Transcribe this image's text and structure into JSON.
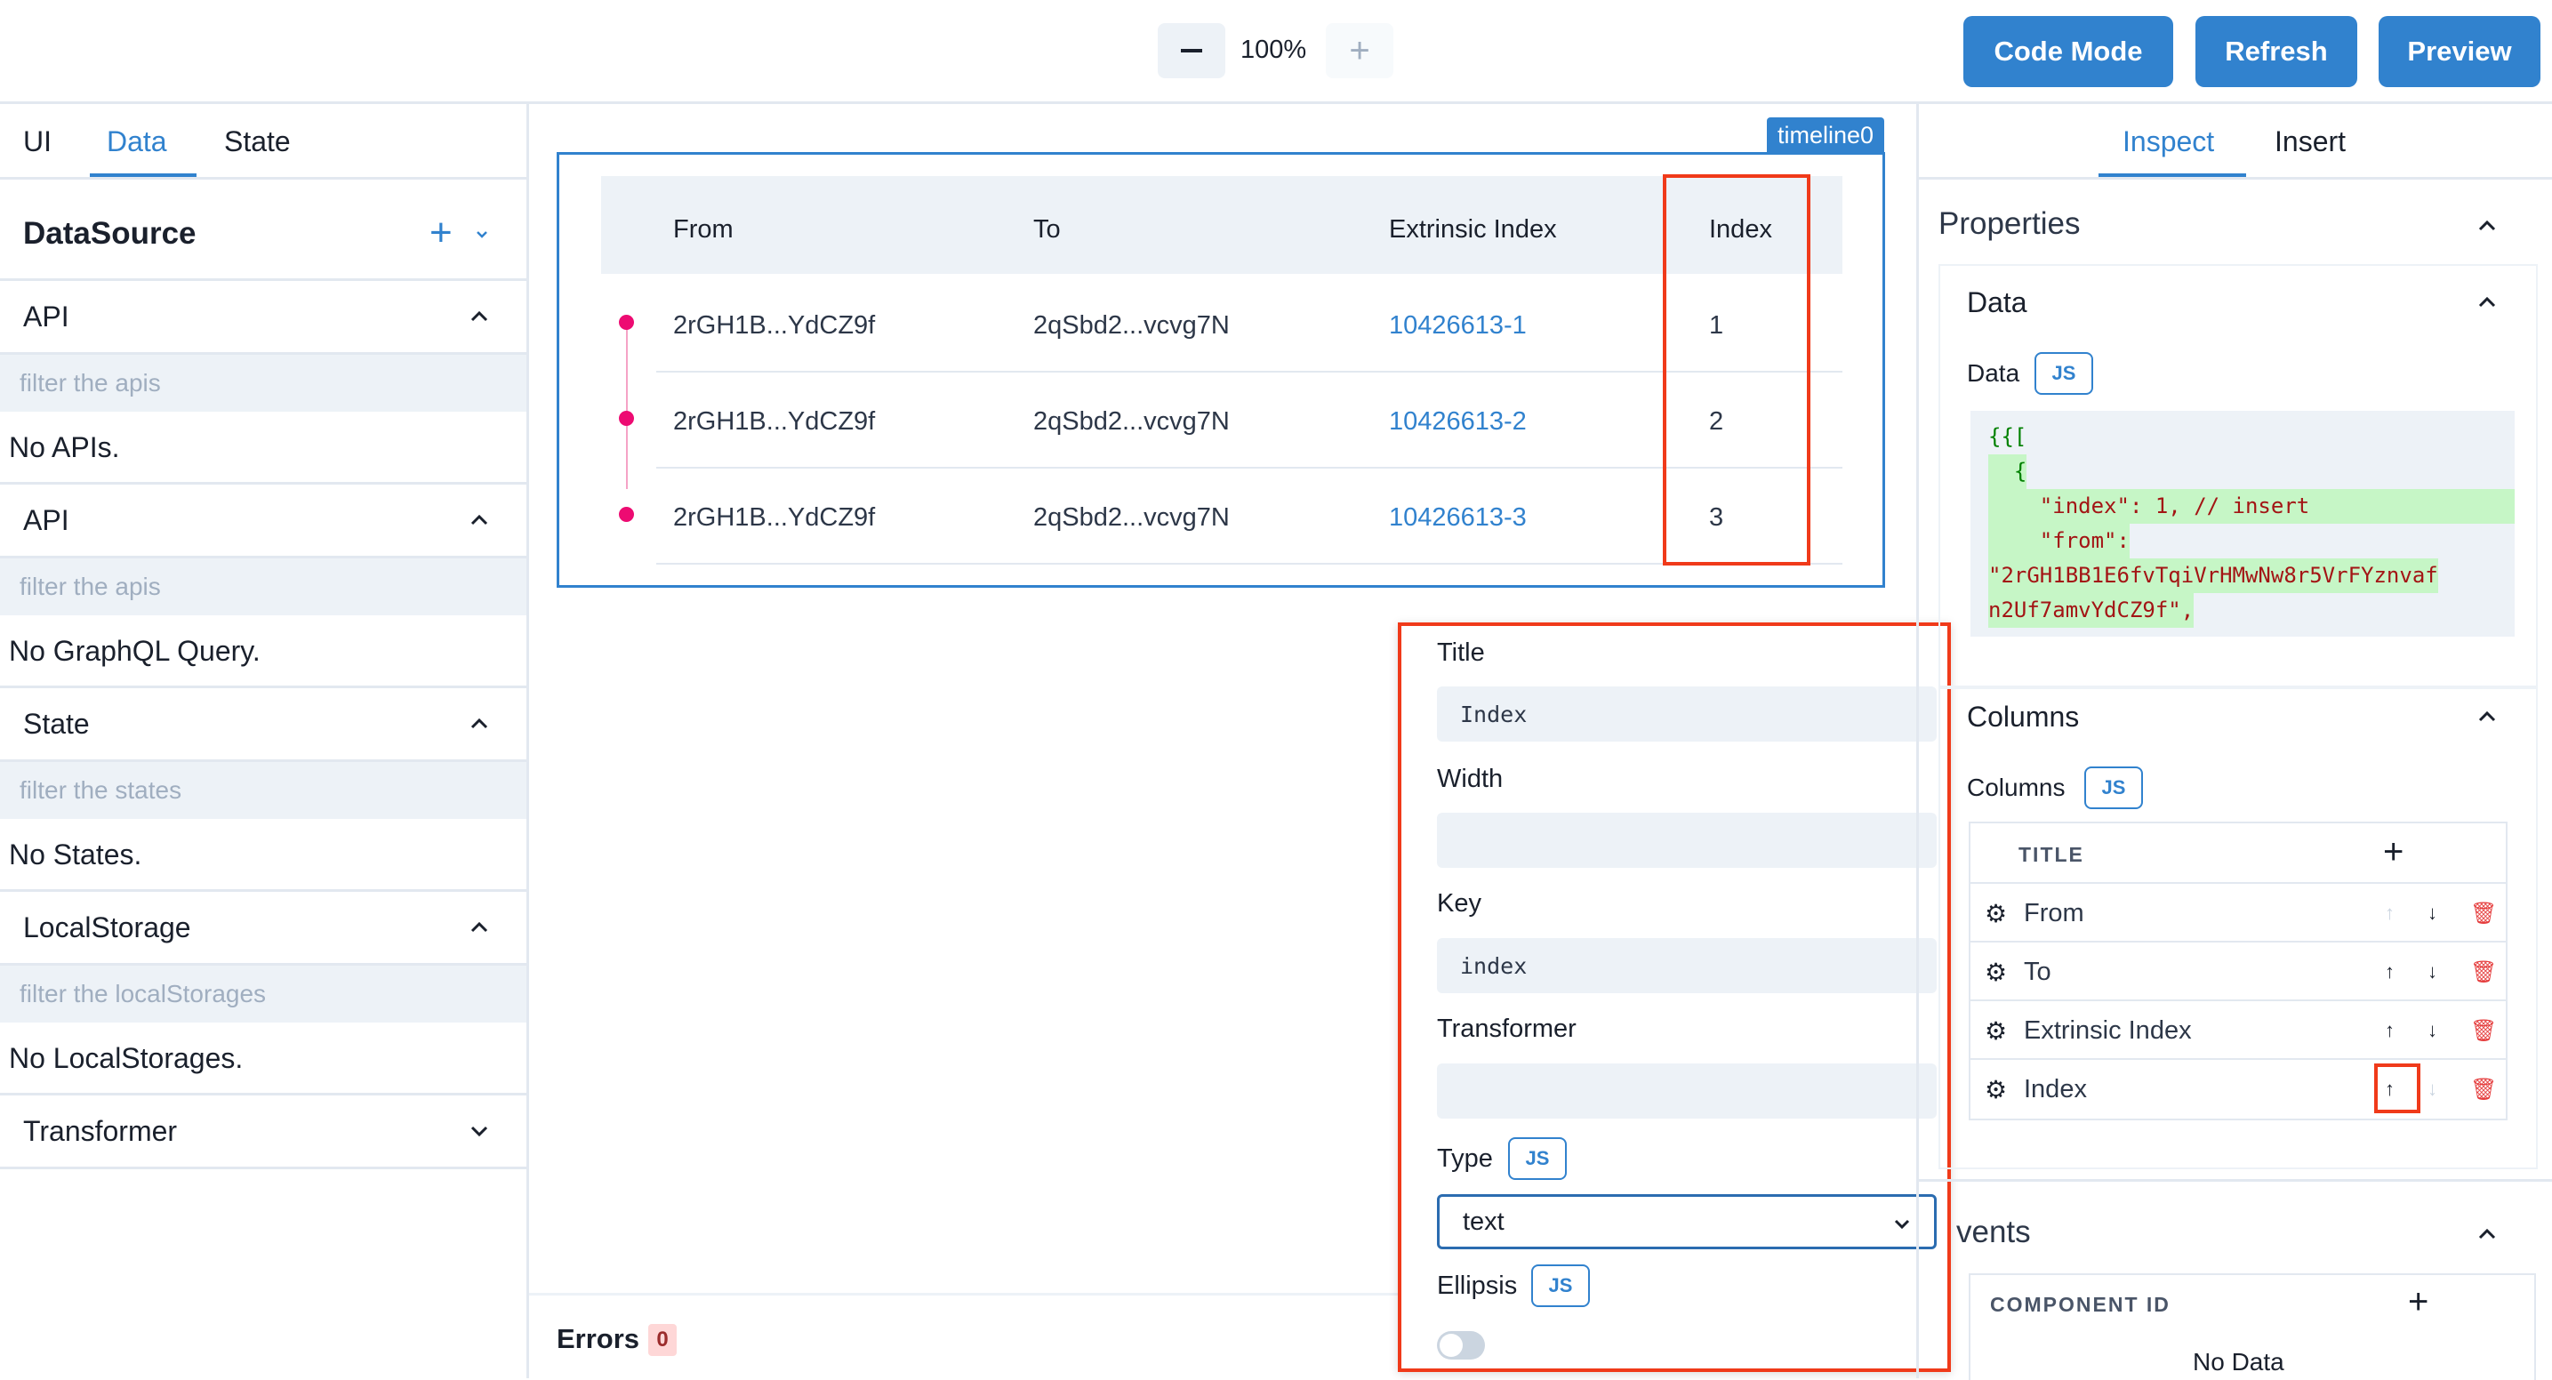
{
  "toolbar": {
    "zoom_out": "−",
    "zoom_level": "100%",
    "zoom_in": "+",
    "code_mode": "Code Mode",
    "refresh": "Refresh",
    "preview": "Preview"
  },
  "left_panel": {
    "tabs": [
      {
        "label": "UI",
        "active": false
      },
      {
        "label": "Data",
        "active": true
      },
      {
        "label": "State",
        "active": false
      }
    ],
    "title": "DataSource",
    "sections": [
      {
        "label": "API",
        "filter_placeholder": "filter the apis",
        "empty": "No APIs."
      },
      {
        "label": "API",
        "filter_placeholder": "filter the apis",
        "empty": "No GraphQL Query."
      },
      {
        "label": "State",
        "filter_placeholder": "filter the states",
        "empty": "No States."
      },
      {
        "label": "LocalStorage",
        "filter_placeholder": "filter the localStorages",
        "empty": "No LocalStorages."
      },
      {
        "label": "Transformer"
      }
    ]
  },
  "canvas": {
    "component_tag": "timeline0",
    "table": {
      "headers": [
        "From",
        "To",
        "Extrinsic Index",
        "Index"
      ],
      "rows": [
        {
          "from": "2rGH1B...YdCZ9f",
          "to": "2qSbd2...vcvg7N",
          "extrinsic": "10426613-1",
          "index": "1"
        },
        {
          "from": "2rGH1B...YdCZ9f",
          "to": "2qSbd2...vcvg7N",
          "extrinsic": "10426613-2",
          "index": "2"
        },
        {
          "from": "2rGH1B...YdCZ9f",
          "to": "2qSbd2...vcvg7N",
          "extrinsic": "10426613-3",
          "index": "3"
        }
      ]
    },
    "errors_label": "Errors",
    "errors_count": "0",
    "accent": "#3182ce",
    "dot_color": "#ed0b72"
  },
  "column_popover": {
    "title_label": "Title",
    "title_value": "Index",
    "width_label": "Width",
    "width_value": "",
    "key_label": "Key",
    "key_value": "index",
    "transformer_label": "Transformer",
    "transformer_value": "",
    "type_label": "Type",
    "type_badge": "JS",
    "type_value": "text",
    "ellipsis_label": "Ellipsis",
    "ellipsis_badge": "JS",
    "ellipsis_on": false
  },
  "right_panel": {
    "tabs": [
      {
        "label": "Inspect",
        "active": true
      },
      {
        "label": "Insert",
        "active": false
      }
    ],
    "properties_title": "Properties",
    "data_section": "Data",
    "data_label": "Data",
    "data_badge": "JS",
    "code_lines": [
      "{{[",
      "  {",
      "    \"index\": 1, // insert",
      "    \"from\":",
      "\"2rGH1BB1E6fvTqiVrHMwNw8r5VrFYznvaf",
      "n2Uf7amvYdCZ9f\","
    ],
    "columns_section": "Columns",
    "columns_label": "Columns",
    "columns_badge": "JS",
    "columns_header": "TITLE",
    "columns": [
      "From",
      "To",
      "Extrinsic Index",
      "Index"
    ],
    "events_section": "vents",
    "events_header": "COMPONENT ID",
    "events_empty": "No Data"
  }
}
